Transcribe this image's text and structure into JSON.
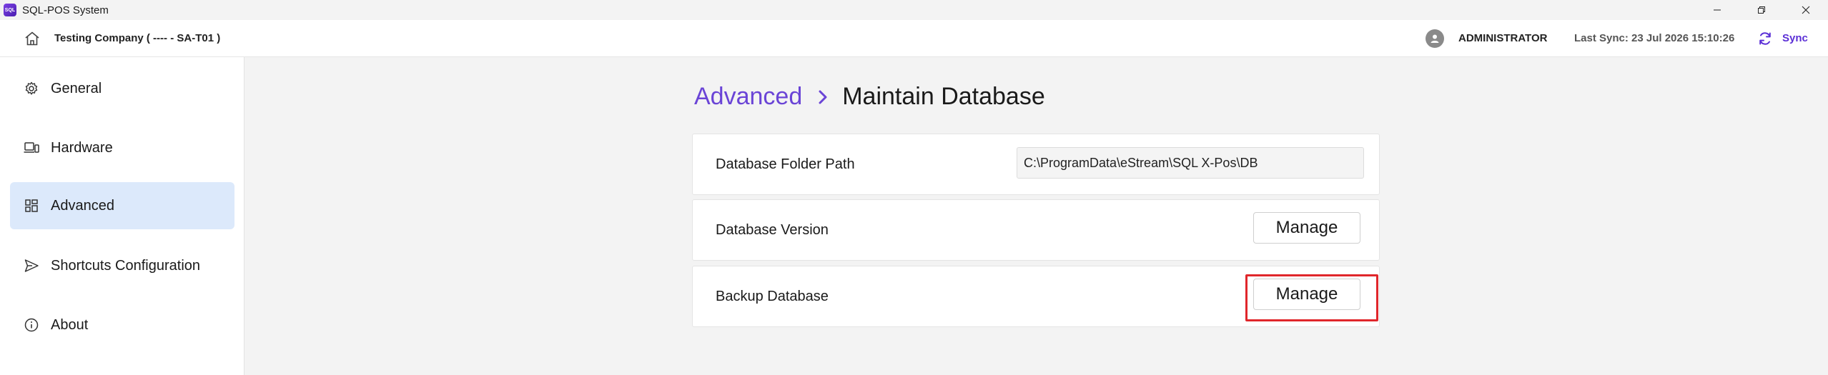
{
  "window": {
    "title": "SQL-POS System",
    "icon_text": "SQL"
  },
  "header": {
    "company": "Testing Company ( ---- - SA-T01 )",
    "user": "ADMINISTRATOR",
    "last_sync": "Last Sync: 23 Jul 2026 15:10:26",
    "sync_label": "Sync"
  },
  "sidebar": {
    "items": [
      {
        "label": "General",
        "icon": "gear-icon"
      },
      {
        "label": "Hardware",
        "icon": "devices-icon"
      },
      {
        "label": "Advanced",
        "icon": "grid-icon",
        "active": true
      },
      {
        "label": "Shortcuts Configuration",
        "icon": "send-icon"
      },
      {
        "label": "About",
        "icon": "info-icon"
      }
    ]
  },
  "main": {
    "breadcrumb": {
      "parent": "Advanced",
      "current": "Maintain Database"
    },
    "rows": [
      {
        "label": "Database Folder Path",
        "path_value": "C:\\ProgramData\\eStream\\SQL X-Pos\\DB"
      },
      {
        "label": "Database Version",
        "button": "Manage"
      },
      {
        "label": "Backup Database",
        "button": "Manage"
      }
    ]
  },
  "colors": {
    "accent": "#6a44d6",
    "sync": "#5b2fd6",
    "active_bg": "#dce9fb",
    "highlight": "#e0262b"
  }
}
